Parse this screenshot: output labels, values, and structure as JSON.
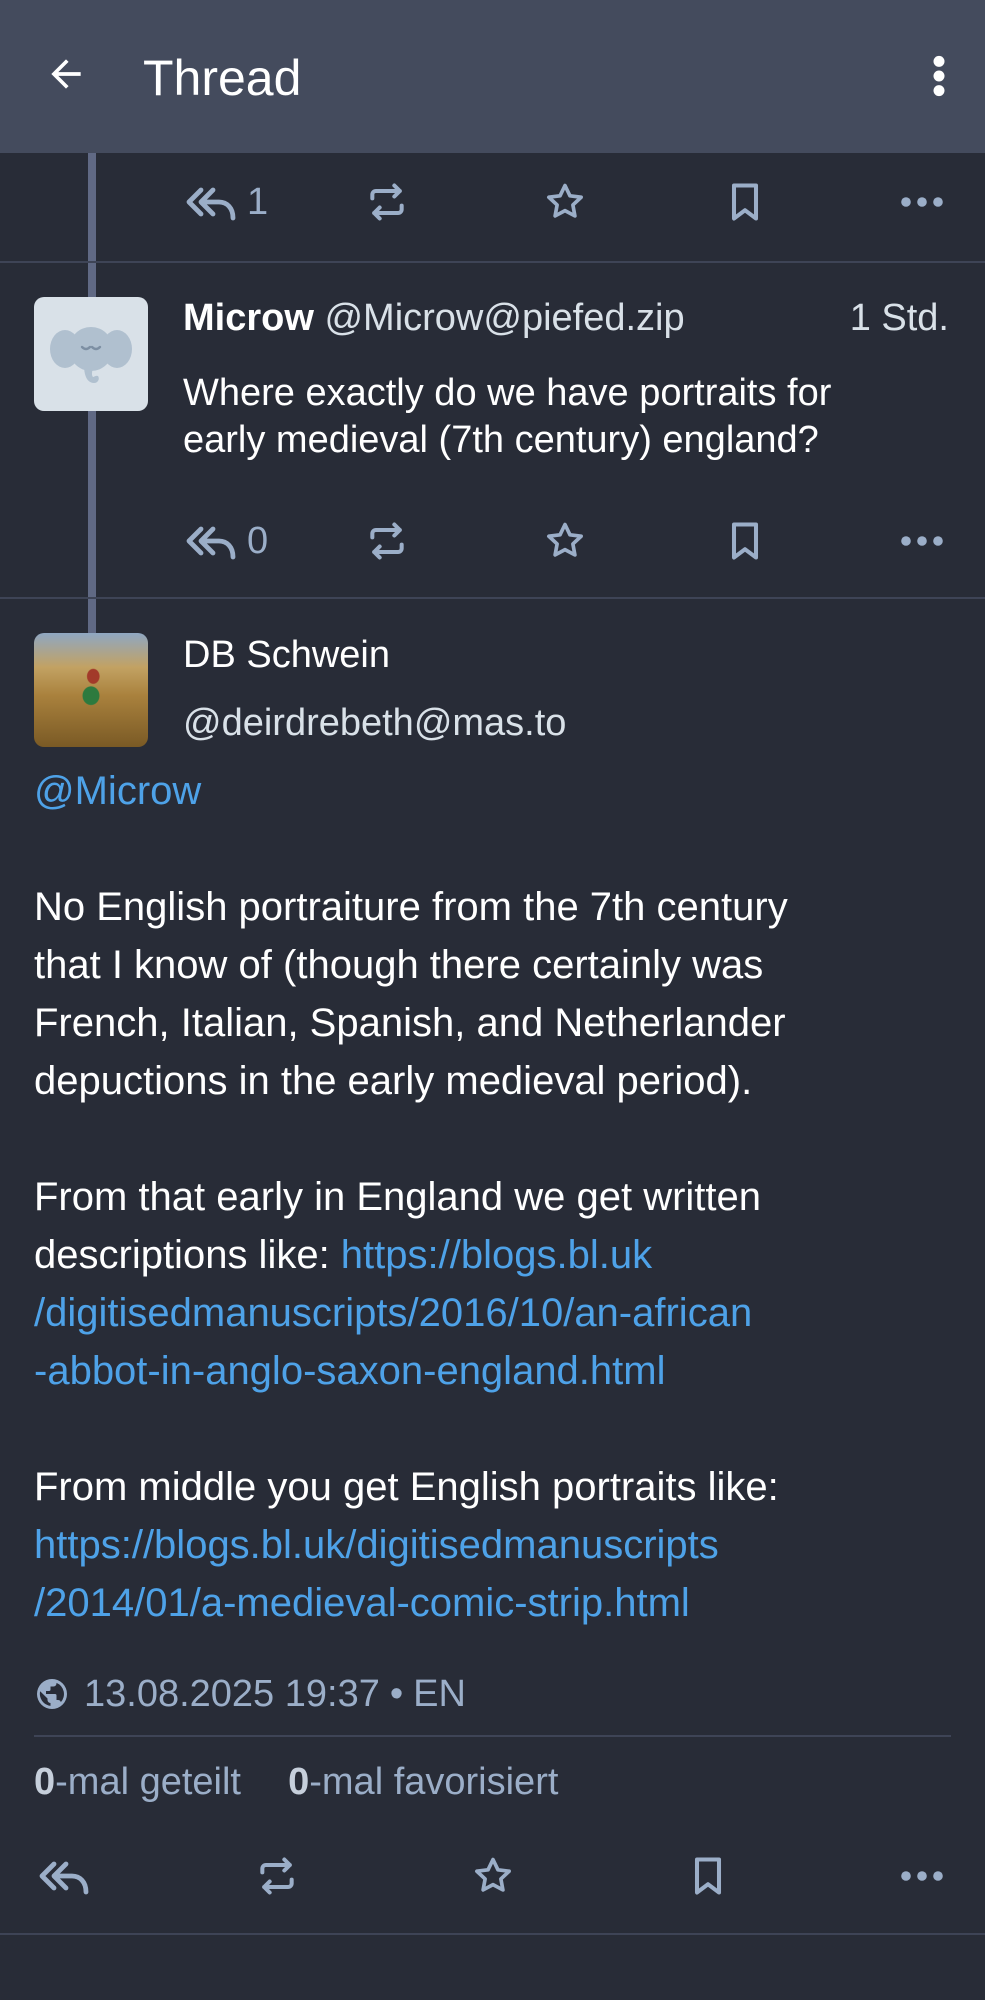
{
  "appbar": {
    "title": "Thread",
    "back_icon": "arrow-left-icon",
    "menu_icon": "more-vertical-icon"
  },
  "colors": {
    "background": "#282c37",
    "appbar": "#444b5d",
    "accent_link": "#4ea2e8",
    "muted": "#9baec8"
  },
  "previous_post_actions": {
    "reply_count": "1"
  },
  "reply_post": {
    "display_name": "Microw",
    "acct": "@Microw@piefed.zip",
    "time": "1 Std.",
    "text_lines": [
      "Where exactly do we have portraits for",
      "early medieval (7th century) england?"
    ],
    "reply_count": "0"
  },
  "main_status": {
    "display_name": "DB Schwein",
    "acct": "@deirdrebeth@mas.to",
    "mention": "@Microw",
    "paragraph1": [
      "No English portraiture from the 7th century",
      "that I know of (though there certainly was",
      "French, Italian, Spanish, and Netherlander",
      "depuctions in the early medieval period)."
    ],
    "paragraph2_text": "From that early in England we get written",
    "paragraph2_prefix": "descriptions like: ",
    "paragraph2_link": [
      "https://blogs.bl.uk",
      "/digitisedmanuscripts/2016/10/an-african",
      "-abbot-in-anglo-saxon-england.html"
    ],
    "paragraph3_text": "From middle you get English portraits like:",
    "paragraph3_link": [
      "https://blogs.bl.uk/digitisedmanuscripts",
      "/2014/01/a-medieval-comic-strip.html"
    ],
    "timestamp": "13.08.2025 19:37",
    "separator": "•",
    "language": "EN",
    "shares_count": "0",
    "shares_label": "-mal geteilt",
    "favs_count": "0",
    "favs_label": "-mal favorisiert"
  }
}
